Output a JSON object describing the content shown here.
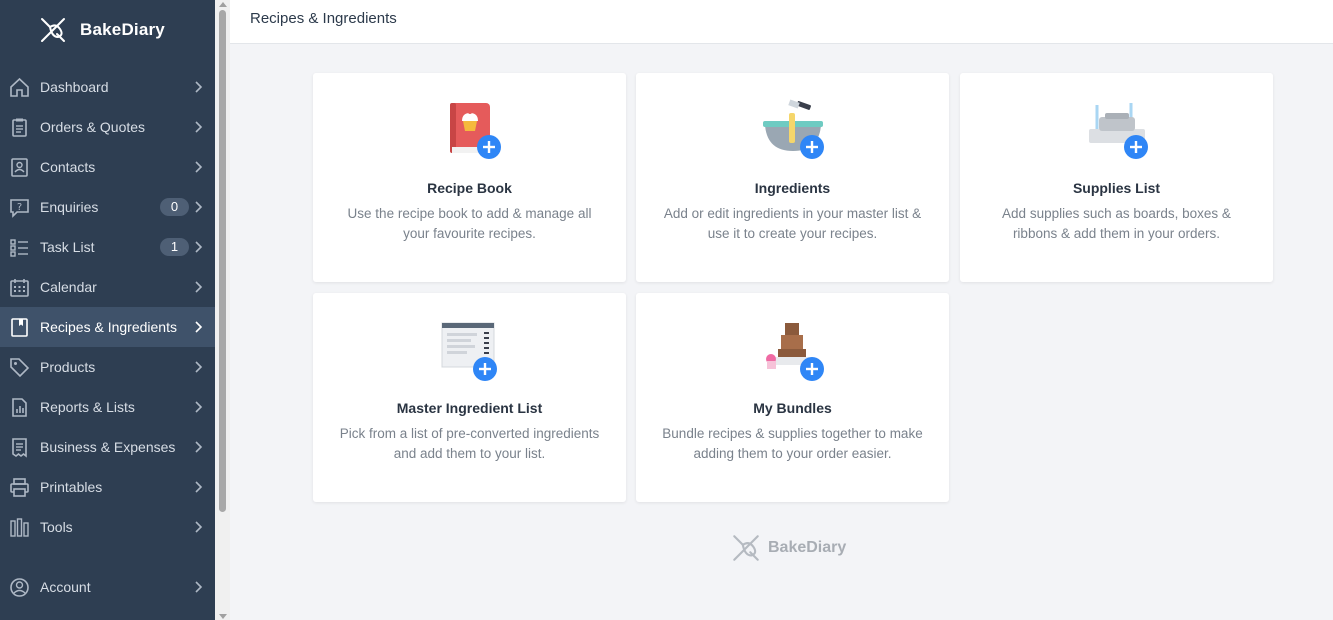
{
  "app": {
    "name": "BakeDiary"
  },
  "header": {
    "title": "Recipes & Ingredients"
  },
  "sidebar": {
    "items": [
      {
        "label": "Dashboard",
        "icon": "home-icon"
      },
      {
        "label": "Orders & Quotes",
        "icon": "clipboard-icon"
      },
      {
        "label": "Contacts",
        "icon": "contact-card-icon"
      },
      {
        "label": "Enquiries",
        "icon": "question-bubble-icon",
        "badge": "0"
      },
      {
        "label": "Task List",
        "icon": "checklist-icon",
        "badge": "1"
      },
      {
        "label": "Calendar",
        "icon": "calendar-icon"
      },
      {
        "label": "Recipes & Ingredients",
        "icon": "book-icon",
        "active": true
      },
      {
        "label": "Products",
        "icon": "tag-icon"
      },
      {
        "label": "Reports & Lists",
        "icon": "report-icon"
      },
      {
        "label": "Business & Expenses",
        "icon": "receipt-icon"
      },
      {
        "label": "Printables",
        "icon": "printer-icon"
      },
      {
        "label": "Tools",
        "icon": "tools-icon"
      },
      {
        "label": "Account",
        "icon": "user-circle-icon"
      }
    ]
  },
  "cards": [
    {
      "title": "Recipe Book",
      "desc": "Use the recipe book to add & manage all your favourite recipes.",
      "icon": "recipe-book-icon"
    },
    {
      "title": "Ingredients",
      "desc": "Add or edit ingredients in your master list & use it to create your recipes.",
      "icon": "mixing-bowl-icon"
    },
    {
      "title": "Supplies List",
      "desc": "Add supplies such as boards, boxes & ribbons & add them in your orders.",
      "icon": "supplies-icon"
    },
    {
      "title": "Master Ingredient List",
      "desc": "Pick from a list of pre-converted ingredients and add them to your list.",
      "icon": "master-list-icon"
    },
    {
      "title": "My Bundles",
      "desc": "Bundle recipes & supplies together to make adding them to your order easier.",
      "icon": "bundle-boxes-icon"
    }
  ],
  "footer": {
    "brand": "BakeDiary"
  },
  "colors": {
    "sidebar": "#2e3e52",
    "sidebar_active": "#3f526a",
    "accent": "#2f86f6",
    "background": "#f3f4f7"
  }
}
